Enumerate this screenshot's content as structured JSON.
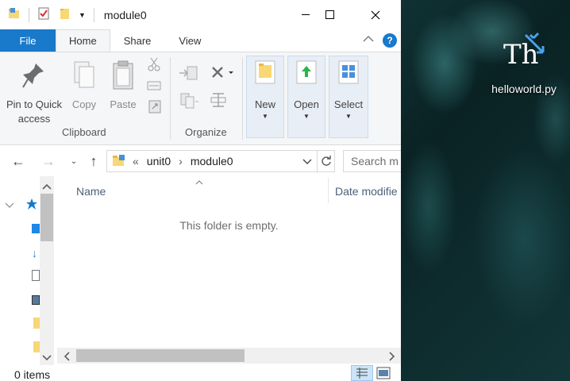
{
  "window": {
    "title": "module0",
    "tabs": {
      "file": "File",
      "home": "Home",
      "share": "Share",
      "view": "View"
    }
  },
  "ribbon": {
    "pin_line1": "Pin to Quick",
    "pin_line2": "access",
    "copy": "Copy",
    "paste": "Paste",
    "clipboard_group": "Clipboard",
    "organize_group": "Organize",
    "new": "New",
    "open": "Open",
    "select": "Select"
  },
  "address": {
    "crumb_prefix": "«",
    "crumbs": [
      "unit0",
      "module0"
    ],
    "search_placeholder": "Search m"
  },
  "columns": {
    "name": "Name",
    "date": "Date modifie"
  },
  "content": {
    "empty_message": "This folder is empty."
  },
  "status": {
    "items": "0 items"
  },
  "desktop": {
    "icon_label": "helloworld.py"
  },
  "colors": {
    "file_tab": "#1979ca",
    "accent": "#0078d7",
    "folder": "#f8d775"
  }
}
